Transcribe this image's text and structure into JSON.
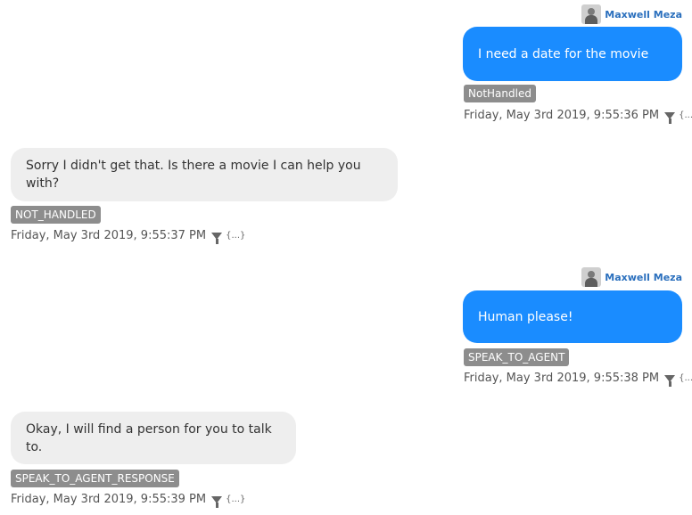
{
  "messages": [
    {
      "user_name": "Maxwell Meza",
      "text": "I need a date for the movie",
      "intent": "NotHandled",
      "timestamp": "Friday, May 3rd 2019, 9:55:36 PM",
      "json_label": "{...}"
    },
    {
      "text": "Sorry I didn't get that. Is there a movie I can help you with?",
      "intent": "NOT_HANDLED",
      "timestamp": "Friday, May 3rd 2019, 9:55:37 PM",
      "json_label": "{...}"
    },
    {
      "user_name": "Maxwell Meza",
      "text": "Human please!",
      "intent": "SPEAK_TO_AGENT",
      "timestamp": "Friday, May 3rd 2019, 9:55:38 PM",
      "json_label": "{...}"
    },
    {
      "text": "Okay, I will find a person for you to talk to.",
      "intent": "SPEAK_TO_AGENT_RESPONSE",
      "timestamp": "Friday, May 3rd 2019, 9:55:39 PM",
      "json_label": "{...}"
    }
  ],
  "colors": {
    "user_bubble": "#1a8cff",
    "bot_bubble": "#eeeeee",
    "intent_badge": "#8d8d8d",
    "user_name": "#2a6fbd"
  }
}
